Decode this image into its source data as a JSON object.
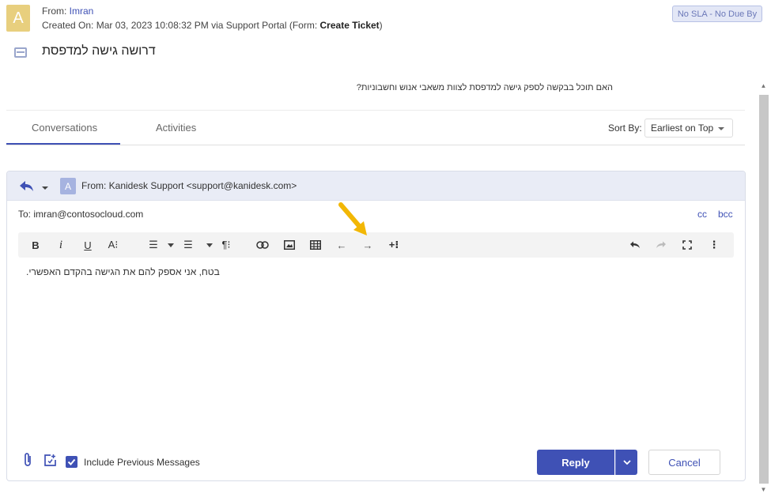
{
  "header": {
    "avatar_letter": "A",
    "from_prefix": "From: ",
    "from_name": "Imran",
    "created_prefix": "Created On: Mar 03, 2023 10:08:32 PM via Support Portal (Form: ",
    "form_name": "Create Ticket",
    "created_suffix": ")",
    "sla_badge": "No SLA - No Due By",
    "subject": "דרושה גישה למדפסת"
  },
  "question": "האם תוכל בבקשה לספק גישה למדפסת לצוות משאבי אנוש וחשבוניות?",
  "tabs": {
    "conversations": "Conversations",
    "activities": "Activities"
  },
  "sort": {
    "label": "Sort By:",
    "value": "Earliest on Top"
  },
  "reply": {
    "avatar_letter": "A",
    "from": "From: Kanidesk Support <support@kanidesk.com>",
    "to": "To: imran@contosocloud.com",
    "cc": "cc",
    "bcc": "bcc",
    "toolbar": {
      "bold": "B",
      "italic": "i",
      "underline": "U",
      "font_size": "A⁝",
      "ordered_list": "☰",
      "unordered_list": "☰",
      "paragraph": "¶⁝",
      "outdent": "←",
      "indent": "→",
      "insert_more": "+⁝",
      "more": "⋮"
    },
    "body": "בטח, אני אספק להם את הגישה בהקדם האפשרי.",
    "include_previous": "Include Previous Messages",
    "reply_button": "Reply",
    "cancel_button": "Cancel"
  },
  "colors": {
    "accent": "#3f51b5",
    "avatar": "#e8cf7e",
    "pointer": "#f2b705"
  }
}
